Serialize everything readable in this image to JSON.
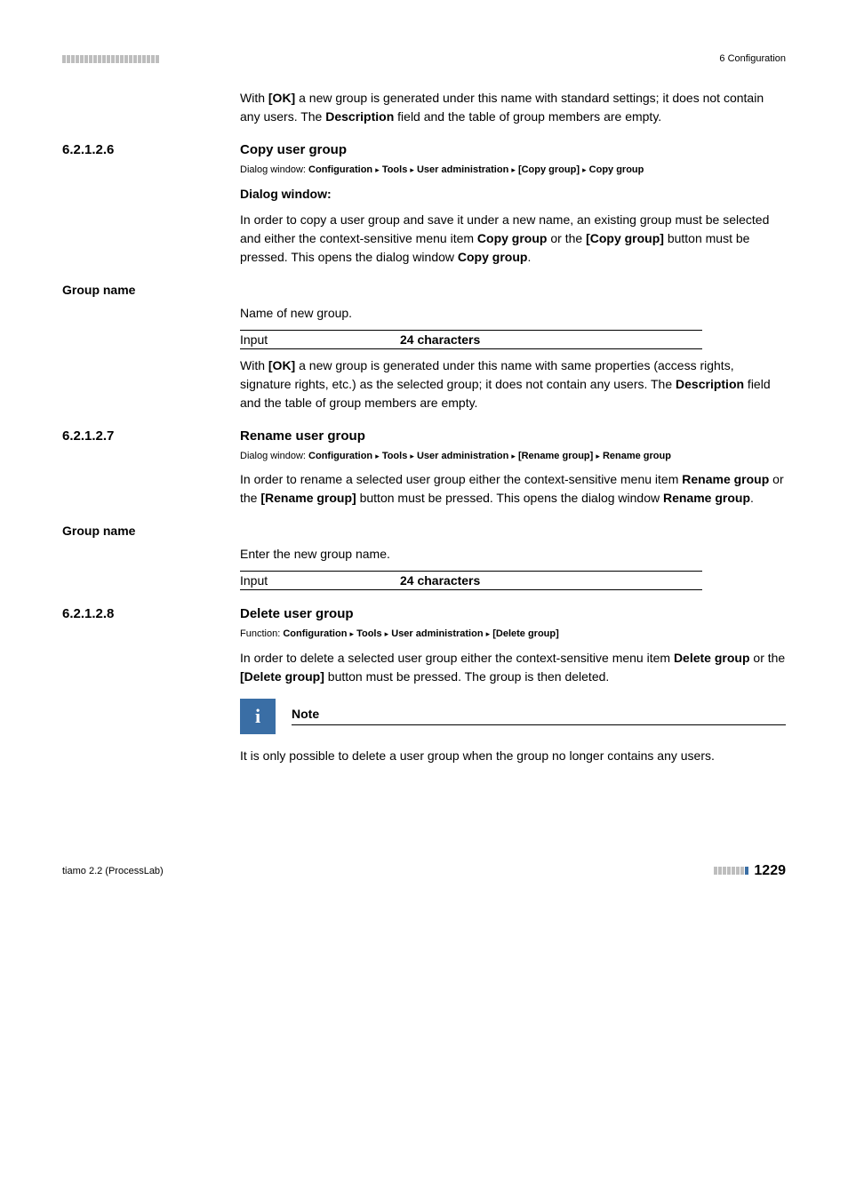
{
  "header": {
    "right": "6 Configuration"
  },
  "intro_para": {
    "pre": "With ",
    "ok": "[OK]",
    "mid": " a new group is generated under this name with standard settings; it does not contain any users. The ",
    "desc": "Description",
    "post": " field and the table of group members are empty."
  },
  "sections": {
    "copy": {
      "num": "6.2.1.2.6",
      "title": "Copy user group",
      "crumb": {
        "lead": "Dialog window: ",
        "p1": "Configuration",
        "p2": "Tools",
        "p3": "User administration",
        "p4": "[Copy group]",
        "p5": "Copy group"
      },
      "dw": "Dialog window:",
      "para": {
        "t1": "In order to copy a user group and save it under a new name, an existing group must be selected and either the context-sensitive menu item ",
        "b1": "Copy group",
        "t2": " or the ",
        "b2": "[Copy group]",
        "t3": " button must be pressed. This opens the dialog window ",
        "b3": "Copy group",
        "t4": "."
      },
      "group_name_label": "Group name",
      "group_name_desc": "Name of new group.",
      "input_label": "Input",
      "input_val": "24 characters",
      "after": {
        "pre": "With ",
        "ok": "[OK]",
        "mid": " a new group is generated under this name with same properties (access rights, signature rights, etc.) as the selected group; it does not contain any users. The ",
        "desc": "Description",
        "post": " field and the table of group members are empty."
      }
    },
    "rename": {
      "num": "6.2.1.2.7",
      "title": "Rename user group",
      "crumb": {
        "lead": "Dialog window: ",
        "p1": "Configuration",
        "p2": "Tools",
        "p3": "User administration",
        "p4": "[Rename group]",
        "p5": "Rename group"
      },
      "para": {
        "t1": "In order to rename a selected user group either the context-sensitive menu item ",
        "b1": "Rename group",
        "t2": " or the ",
        "b2": "[Rename group]",
        "t3": " button must be pressed. This opens the dialog window ",
        "b3": "Rename group",
        "t4": "."
      },
      "group_name_label": "Group name",
      "group_name_desc": "Enter the new group name.",
      "input_label": "Input",
      "input_val": "24 characters"
    },
    "delete": {
      "num": "6.2.1.2.8",
      "title": "Delete user group",
      "crumb": {
        "lead": "Function: ",
        "p1": "Configuration",
        "p2": "Tools",
        "p3": "User administration",
        "p4": "[Delete group]"
      },
      "para": {
        "t1": "In order to delete a selected user group either the context-sensitive menu item ",
        "b1": "Delete group",
        "t2": " or the ",
        "b2": "[Delete group]",
        "t3": " button must be pressed. The group is then deleted."
      },
      "note_title": "Note",
      "note_text": "It is only possible to delete a user group when the group no longer contains any users."
    }
  },
  "footer": {
    "left": "tiamo 2.2 (ProcessLab)",
    "page": "1229"
  },
  "tri": "▸"
}
